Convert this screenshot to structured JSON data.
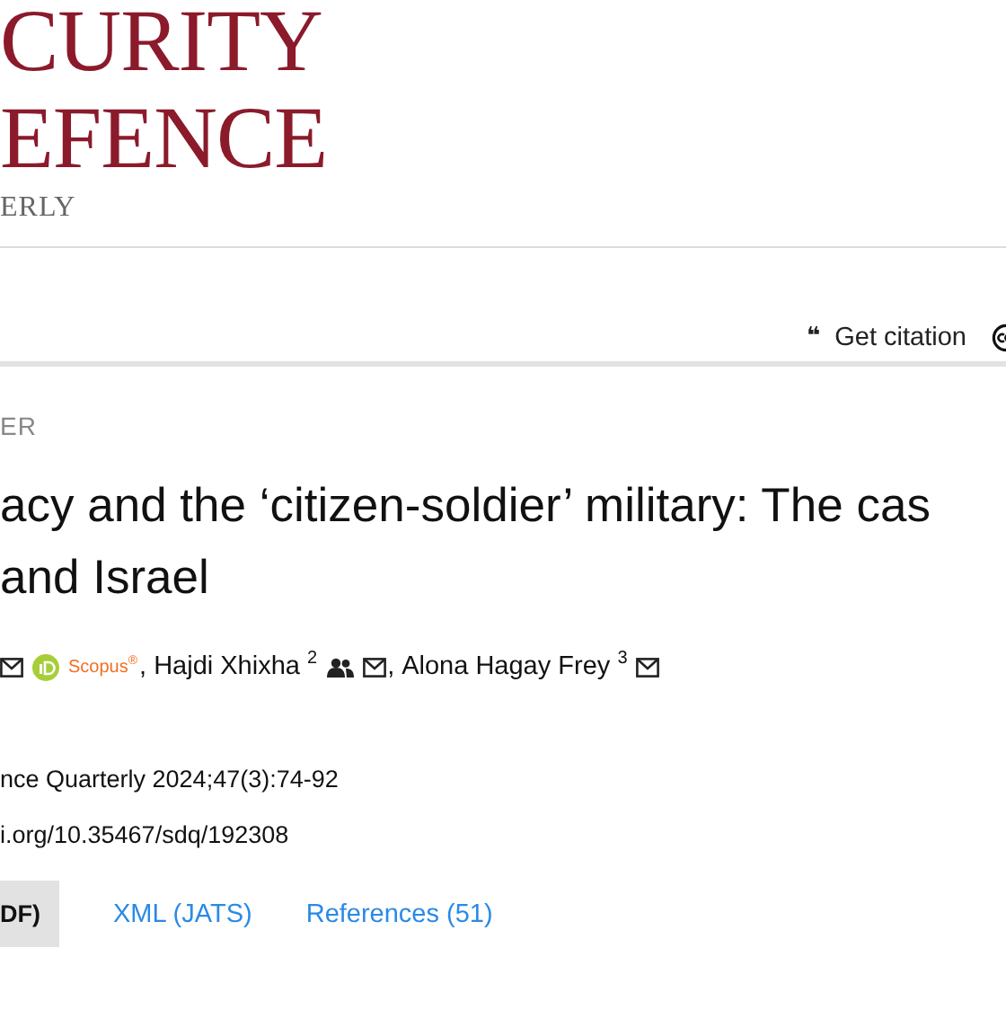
{
  "logo": {
    "line_1": "CURITY",
    "line_2": "EFENCE",
    "line_3": "ERLY"
  },
  "toolbar": {
    "citation": {
      "icon": "❝",
      "label": "Get citation"
    }
  },
  "article": {
    "section": "ER",
    "title_lines": [
      "acy and the ‘citizen-soldier’ military: The cas",
      "and Israel"
    ],
    "authors": [
      {
        "kind": "icons",
        "scopus": "Scopus",
        "scopus_mark": "®"
      },
      {
        "kind": "author",
        "separator": ",",
        "name": "Hajdi Xhixha",
        "affiliation": "2",
        "corresponding": true
      },
      {
        "kind": "author",
        "separator": ",",
        "name": "Alona Hagay Frey",
        "affiliation": "3",
        "corresponding": false
      }
    ],
    "journal": "nce Quarterly 2024;47(3):74-92",
    "doi": "i.org/10.35467/sdq/192308",
    "downloads": [
      {
        "label": "DF)",
        "selected": true
      },
      {
        "label": "XML (JATS)",
        "selected": false
      },
      {
        "label": "References (51)",
        "selected": false
      }
    ]
  }
}
